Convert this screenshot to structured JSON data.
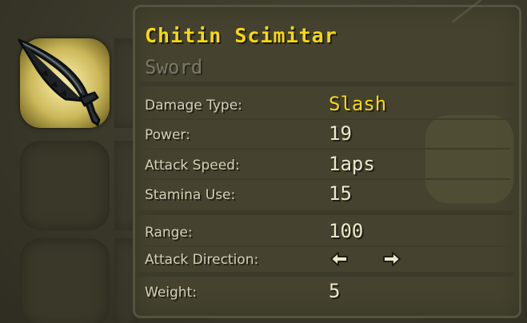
{
  "item": {
    "name": "Chitin Scimitar",
    "category": "Sword",
    "icon": "curved-black-scimitar"
  },
  "stats": [
    {
      "label": "Damage Type:",
      "value": "Slash"
    },
    {
      "label": "Power:",
      "value": "19"
    },
    {
      "label": "Attack Speed:",
      "value": "1aps"
    },
    {
      "label": "Stamina Use:",
      "value": "15"
    },
    {
      "label": "Range:",
      "value": "100"
    },
    {
      "label": "Attack Direction:",
      "value_icons": [
        "left-arrow-icon",
        "right-arrow-icon"
      ]
    },
    {
      "label": "Weight:",
      "value": "5"
    }
  ],
  "colors": {
    "title": "#f6d80f",
    "damage_type": "#f6d80f",
    "label": "#d2ceb3",
    "value": "#ece7c9",
    "subtitle": "#7a7766",
    "selected_slot": "#e8d989",
    "background": "#3a3829"
  }
}
